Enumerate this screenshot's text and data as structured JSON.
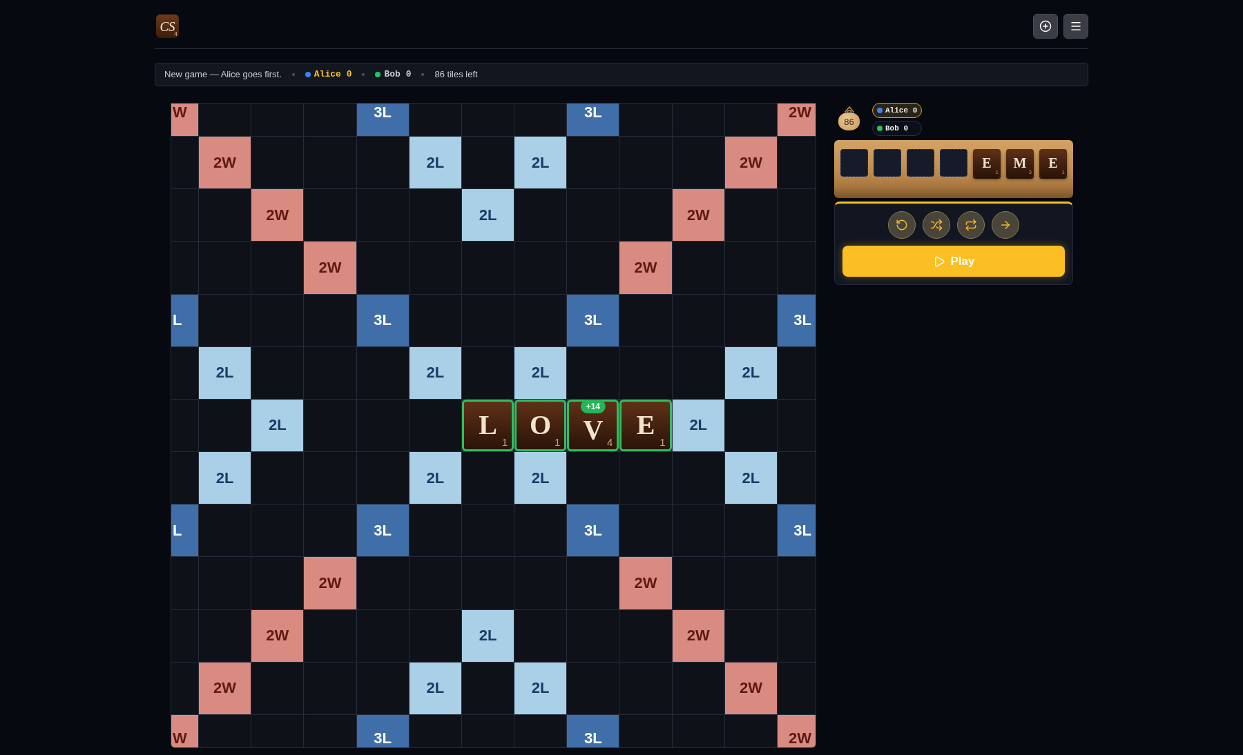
{
  "header": {
    "logo": {
      "letters": "CS",
      "points": "4"
    }
  },
  "status_bar": {
    "message": "New game — Alice goes first.",
    "players": [
      {
        "name": "Alice",
        "score": "0",
        "color": "#3b82f6",
        "selected": true
      },
      {
        "name": "Bob",
        "score": "0",
        "color": "#22c55e",
        "selected": false
      }
    ],
    "tiles_left": "86 tiles left"
  },
  "board": {
    "rows": [
      {
        "cells": [
          {
            "kind": "double_word",
            "label": "W"
          },
          {
            "kind": "empty"
          },
          {
            "kind": "empty"
          },
          {
            "kind": "empty"
          },
          {
            "kind": "triple_letter",
            "label": "3L"
          },
          {
            "kind": "empty"
          },
          {
            "kind": "empty"
          },
          {
            "kind": "empty"
          },
          {
            "kind": "triple_letter",
            "label": "3L"
          },
          {
            "kind": "empty"
          },
          {
            "kind": "empty"
          },
          {
            "kind": "empty"
          },
          {
            "kind": "double_word",
            "label": "2W"
          }
        ]
      },
      {
        "cells": [
          {
            "kind": "empty"
          },
          {
            "kind": "double_word",
            "label": "2W"
          },
          {
            "kind": "empty"
          },
          {
            "kind": "empty"
          },
          {
            "kind": "empty"
          },
          {
            "kind": "double_letter",
            "label": "2L"
          },
          {
            "kind": "empty"
          },
          {
            "kind": "double_letter",
            "label": "2L"
          },
          {
            "kind": "empty"
          },
          {
            "kind": "empty"
          },
          {
            "kind": "empty"
          },
          {
            "kind": "double_word",
            "label": "2W"
          },
          {
            "kind": "empty"
          }
        ]
      },
      {
        "cells": [
          {
            "kind": "empty"
          },
          {
            "kind": "empty"
          },
          {
            "kind": "double_word",
            "label": "2W"
          },
          {
            "kind": "empty"
          },
          {
            "kind": "empty"
          },
          {
            "kind": "empty"
          },
          {
            "kind": "double_letter",
            "label": "2L"
          },
          {
            "kind": "empty"
          },
          {
            "kind": "empty"
          },
          {
            "kind": "empty"
          },
          {
            "kind": "double_word",
            "label": "2W"
          },
          {
            "kind": "empty"
          },
          {
            "kind": "empty"
          }
        ]
      },
      {
        "cells": [
          {
            "kind": "empty"
          },
          {
            "kind": "empty"
          },
          {
            "kind": "empty"
          },
          {
            "kind": "double_word",
            "label": "2W"
          },
          {
            "kind": "empty"
          },
          {
            "kind": "empty"
          },
          {
            "kind": "empty"
          },
          {
            "kind": "empty"
          },
          {
            "kind": "empty"
          },
          {
            "kind": "double_word",
            "label": "2W"
          },
          {
            "kind": "empty"
          },
          {
            "kind": "empty"
          },
          {
            "kind": "empty"
          }
        ]
      },
      {
        "cells": [
          {
            "kind": "triple_letter",
            "label": "L"
          },
          {
            "kind": "empty"
          },
          {
            "kind": "empty"
          },
          {
            "kind": "empty"
          },
          {
            "kind": "triple_letter",
            "label": "3L"
          },
          {
            "kind": "empty"
          },
          {
            "kind": "empty"
          },
          {
            "kind": "empty"
          },
          {
            "kind": "triple_letter",
            "label": "3L"
          },
          {
            "kind": "empty"
          },
          {
            "kind": "empty"
          },
          {
            "kind": "empty"
          },
          {
            "kind": "triple_letter",
            "label": "3L"
          }
        ]
      },
      {
        "cells": [
          {
            "kind": "empty"
          },
          {
            "kind": "double_letter",
            "label": "2L"
          },
          {
            "kind": "empty"
          },
          {
            "kind": "empty"
          },
          {
            "kind": "empty"
          },
          {
            "kind": "double_letter",
            "label": "2L"
          },
          {
            "kind": "empty"
          },
          {
            "kind": "double_letter",
            "label": "2L"
          },
          {
            "kind": "empty"
          },
          {
            "kind": "empty"
          },
          {
            "kind": "empty"
          },
          {
            "kind": "double_letter",
            "label": "2L"
          },
          {
            "kind": "empty"
          }
        ]
      },
      {
        "cells": [
          {
            "kind": "empty"
          },
          {
            "kind": "empty"
          },
          {
            "kind": "double_letter",
            "label": "2L"
          },
          {
            "kind": "empty"
          },
          {
            "kind": "empty"
          },
          {
            "kind": "empty"
          },
          {
            "kind": "tile",
            "letter": "L",
            "points": "1",
            "placed": true
          },
          {
            "kind": "tile",
            "letter": "O",
            "points": "1",
            "placed": true
          },
          {
            "kind": "tile",
            "letter": "V",
            "points": "4",
            "placed": true,
            "badge": "+14"
          },
          {
            "kind": "tile",
            "letter": "E",
            "points": "1",
            "placed": true
          },
          {
            "kind": "double_letter",
            "label": "2L"
          },
          {
            "kind": "empty"
          },
          {
            "kind": "empty"
          }
        ]
      },
      {
        "cells": [
          {
            "kind": "empty"
          },
          {
            "kind": "double_letter",
            "label": "2L"
          },
          {
            "kind": "empty"
          },
          {
            "kind": "empty"
          },
          {
            "kind": "empty"
          },
          {
            "kind": "double_letter",
            "label": "2L"
          },
          {
            "kind": "empty"
          },
          {
            "kind": "double_letter",
            "label": "2L"
          },
          {
            "kind": "empty"
          },
          {
            "kind": "empty"
          },
          {
            "kind": "empty"
          },
          {
            "kind": "double_letter",
            "label": "2L"
          },
          {
            "kind": "empty"
          }
        ]
      },
      {
        "cells": [
          {
            "kind": "triple_letter",
            "label": "L"
          },
          {
            "kind": "empty"
          },
          {
            "kind": "empty"
          },
          {
            "kind": "empty"
          },
          {
            "kind": "triple_letter",
            "label": "3L"
          },
          {
            "kind": "empty"
          },
          {
            "kind": "empty"
          },
          {
            "kind": "empty"
          },
          {
            "kind": "triple_letter",
            "label": "3L"
          },
          {
            "kind": "empty"
          },
          {
            "kind": "empty"
          },
          {
            "kind": "empty"
          },
          {
            "kind": "triple_letter",
            "label": "3L"
          }
        ]
      },
      {
        "cells": [
          {
            "kind": "empty"
          },
          {
            "kind": "empty"
          },
          {
            "kind": "empty"
          },
          {
            "kind": "double_word",
            "label": "2W"
          },
          {
            "kind": "empty"
          },
          {
            "kind": "empty"
          },
          {
            "kind": "empty"
          },
          {
            "kind": "empty"
          },
          {
            "kind": "empty"
          },
          {
            "kind": "double_word",
            "label": "2W"
          },
          {
            "kind": "empty"
          },
          {
            "kind": "empty"
          },
          {
            "kind": "empty"
          }
        ]
      },
      {
        "cells": [
          {
            "kind": "empty"
          },
          {
            "kind": "empty"
          },
          {
            "kind": "double_word",
            "label": "2W"
          },
          {
            "kind": "empty"
          },
          {
            "kind": "empty"
          },
          {
            "kind": "empty"
          },
          {
            "kind": "double_letter",
            "label": "2L"
          },
          {
            "kind": "empty"
          },
          {
            "kind": "empty"
          },
          {
            "kind": "empty"
          },
          {
            "kind": "double_word",
            "label": "2W"
          },
          {
            "kind": "empty"
          },
          {
            "kind": "empty"
          }
        ]
      },
      {
        "cells": [
          {
            "kind": "empty"
          },
          {
            "kind": "double_word",
            "label": "2W"
          },
          {
            "kind": "empty"
          },
          {
            "kind": "empty"
          },
          {
            "kind": "empty"
          },
          {
            "kind": "double_letter",
            "label": "2L"
          },
          {
            "kind": "empty"
          },
          {
            "kind": "double_letter",
            "label": "2L"
          },
          {
            "kind": "empty"
          },
          {
            "kind": "empty"
          },
          {
            "kind": "empty"
          },
          {
            "kind": "double_word",
            "label": "2W"
          },
          {
            "kind": "empty"
          }
        ]
      },
      {
        "cells": [
          {
            "kind": "double_word",
            "label": "W"
          },
          {
            "kind": "empty"
          },
          {
            "kind": "empty"
          },
          {
            "kind": "empty"
          },
          {
            "kind": "triple_letter",
            "label": "3L"
          },
          {
            "kind": "empty"
          },
          {
            "kind": "empty"
          },
          {
            "kind": "empty"
          },
          {
            "kind": "triple_letter",
            "label": "3L"
          },
          {
            "kind": "empty"
          },
          {
            "kind": "empty"
          },
          {
            "kind": "empty"
          },
          {
            "kind": "double_word",
            "label": "2W"
          }
        ]
      }
    ]
  },
  "sidebar": {
    "bag": {
      "count": "86"
    },
    "players": [
      {
        "name": "Alice",
        "score": "0",
        "color": "#3b82f6",
        "selected": true
      },
      {
        "name": "Bob",
        "score": "0",
        "color": "#22c55e",
        "selected": false
      }
    ],
    "rack": {
      "slots": [
        {
          "kind": "empty"
        },
        {
          "kind": "empty"
        },
        {
          "kind": "empty"
        },
        {
          "kind": "empty"
        },
        {
          "kind": "tile",
          "letter": "E",
          "points": "1"
        },
        {
          "kind": "tile",
          "letter": "M",
          "points": "3"
        },
        {
          "kind": "tile",
          "letter": "E",
          "points": "1"
        }
      ]
    },
    "actions": {
      "play": {
        "label": "Play"
      }
    }
  }
}
